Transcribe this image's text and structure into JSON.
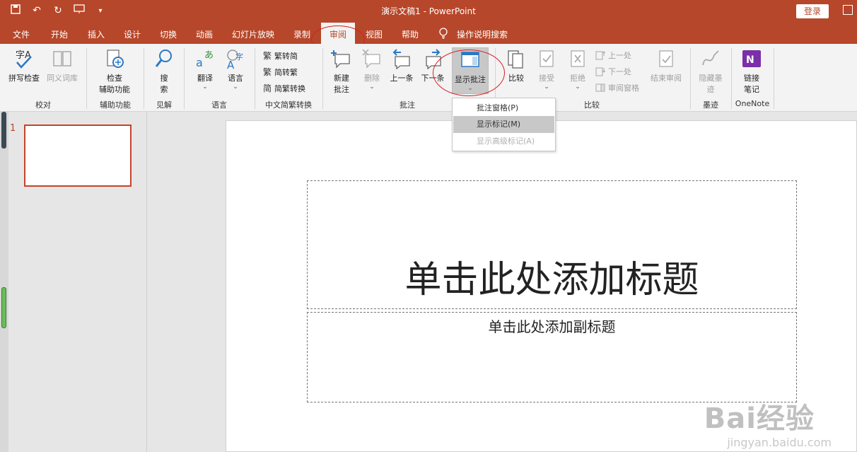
{
  "titlebar": {
    "title": "演示文稿1  -  PowerPoint",
    "login": "登录"
  },
  "menu": {
    "tabs": [
      "文件",
      "开始",
      "插入",
      "设计",
      "切换",
      "动画",
      "幻灯片放映",
      "录制",
      "审阅",
      "视图",
      "帮助"
    ],
    "active": "审阅",
    "search": "操作说明搜索"
  },
  "ribbon": {
    "proofing": {
      "spell": "拼写检查",
      "thesaurus": "同义词库",
      "label": "校对"
    },
    "accessibility": {
      "check": "检查",
      "check2": "辅助功能",
      "label": "辅助功能"
    },
    "insights": {
      "search": "搜",
      "search2": "索",
      "label": "见解"
    },
    "language": {
      "translate": "翻译",
      "language": "语言",
      "label": "语言"
    },
    "chinese": {
      "t2s": "繁转简",
      "s2t": "简转繁",
      "convert": "简繁转换",
      "label": "中文简繁转换"
    },
    "comments": {
      "new": "新建",
      "new2": "批注",
      "delete": "删除",
      "prev": "上一条",
      "next": "下一条",
      "show": "显示批注",
      "label": "批注"
    },
    "compare": {
      "compare": "比较",
      "accept": "接受",
      "reject": "拒绝",
      "prev": "上一处",
      "next": "下一处",
      "pane": "审阅窗格",
      "end": "结束审阅",
      "label": "比较"
    },
    "ink": {
      "hide": "隐藏墨",
      "hide2": "迹",
      "label": "墨迹"
    },
    "onenote": {
      "link": "链接",
      "link2": "笔记",
      "label": "OneNote"
    }
  },
  "dropdown": {
    "items": [
      "批注窗格(P)",
      "显示标记(M)",
      "显示高级标记(A)"
    ]
  },
  "slides": {
    "number": "1",
    "title_placeholder": "单击此处添加标题",
    "subtitle_placeholder": "单击此处添加副标题"
  },
  "watermark": {
    "brand": "Bai经验",
    "url": "jingyan.baidu.com"
  },
  "colors": {
    "accent": "#b7472a",
    "annotation": "#d62020"
  }
}
